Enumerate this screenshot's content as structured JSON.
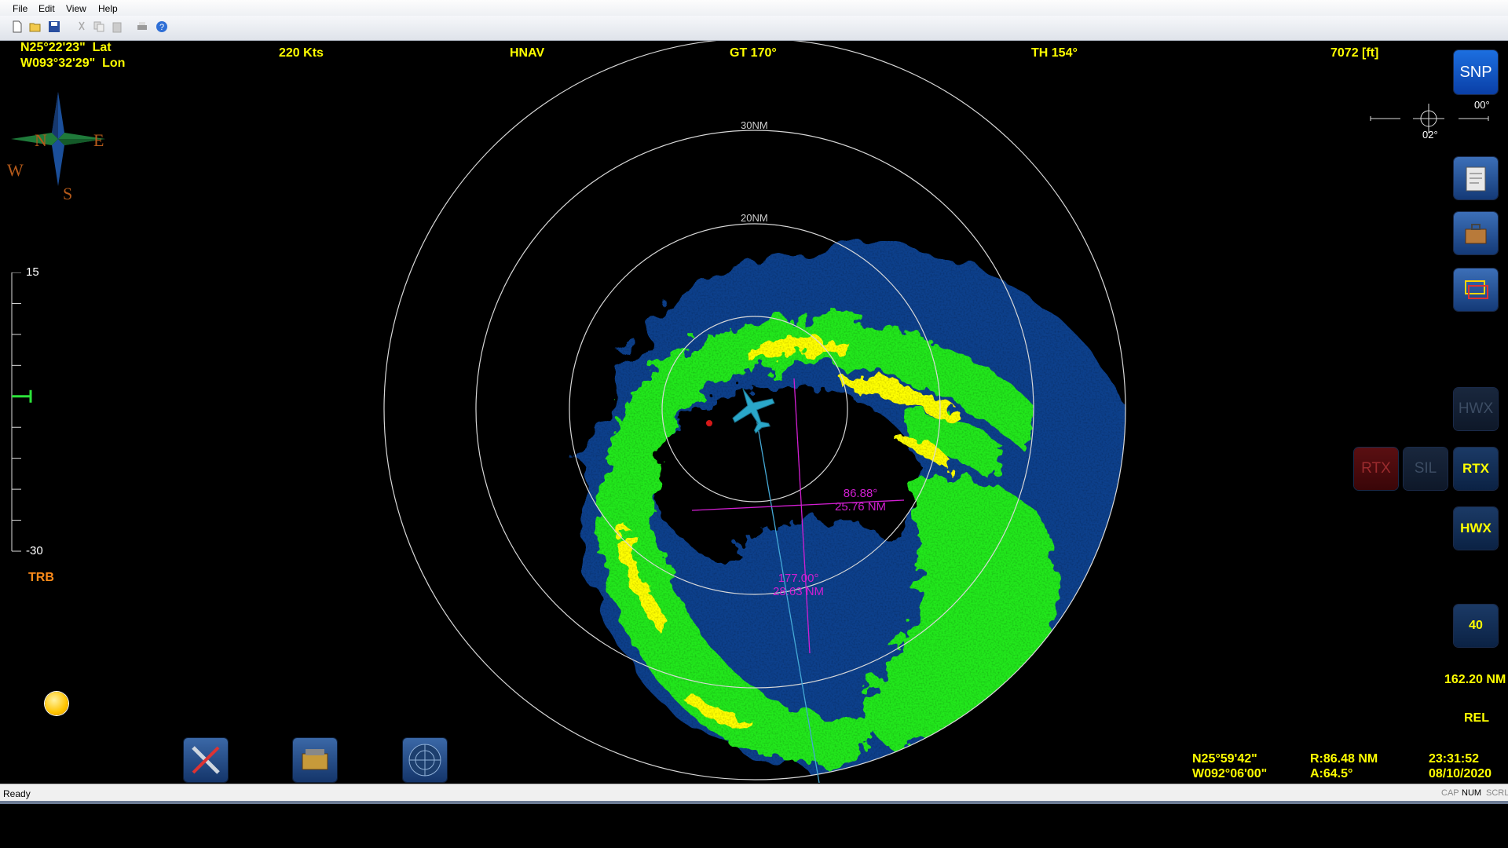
{
  "menu": [
    "File",
    "Edit",
    "View",
    "Help"
  ],
  "toolbar_icons": [
    "new-icon",
    "open-icon",
    "save-icon",
    "cut-icon",
    "copy-icon",
    "paste-icon",
    "print-icon",
    "help-icon"
  ],
  "position": {
    "lat": "N25°22'23\"  Lat",
    "lon": "W093°32'29\"  Lon"
  },
  "header": {
    "speed": "220 Kts",
    "mode": "HNAV",
    "ground_track": "GT 170°",
    "true_heading": "TH 154°",
    "altitude": "7072 [ft]"
  },
  "compass": {
    "n": "N",
    "e": "E",
    "w": "W",
    "s": "S"
  },
  "range_rings": {
    "outer": "30NM",
    "inner": "20NM"
  },
  "tilt_scale": {
    "top": "15",
    "bottom": "-30",
    "label": "TRB",
    "marker_value": -5
  },
  "attitude": {
    "roll": "00°",
    "pitch": "02°"
  },
  "cursor_markers": {
    "marker1": {
      "bearing": "86.88°",
      "distance": "25.76 NM"
    },
    "marker2": {
      "bearing": "177.00°",
      "distance": "28.63 NM"
    }
  },
  "right_buttons": {
    "snp": "SNP",
    "hwx_dim": "HWX",
    "rtx_red": "RTX",
    "sil": "SIL",
    "rtx": "RTX",
    "hwx": "HWX",
    "range": "40"
  },
  "range_readout": "162.20 NM",
  "ref_mode": "REL",
  "cursor": {
    "lat": "N25°59'42\"",
    "lon": "W092°06'00\"",
    "range": "R:86.48 NM",
    "azimuth": "A:64.5°"
  },
  "clock": {
    "time": "23:31:52",
    "date": "08/10/2020"
  },
  "status": {
    "text": "Ready",
    "cap": "CAP",
    "num": "NUM",
    "scrl": "SCRL"
  },
  "colors": {
    "weak": "#0a3f8c",
    "moderate": "#22e81a",
    "strong": "#ffff00",
    "severe": "#e01a1a",
    "label": "#ffff00",
    "marker": "#d21fd2"
  }
}
